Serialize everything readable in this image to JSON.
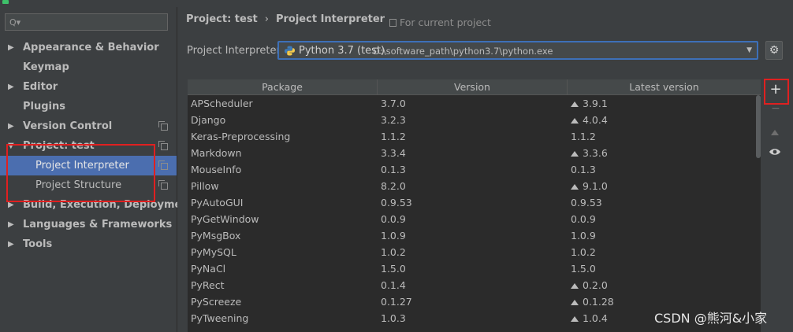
{
  "search": {
    "placeholder": ""
  },
  "sidebar": {
    "items": [
      {
        "label": "Appearance & Behavior",
        "expandable": true,
        "arrow": "▶"
      },
      {
        "label": "Keymap",
        "expandable": false
      },
      {
        "label": "Editor",
        "expandable": true,
        "arrow": "▶"
      },
      {
        "label": "Plugins",
        "expandable": false
      },
      {
        "label": "Version Control",
        "expandable": true,
        "arrow": "▶",
        "copy_icon": true
      },
      {
        "label": "Project: test",
        "expandable": true,
        "arrow": "▼",
        "copy_icon": true
      },
      {
        "label": "Project Interpreter",
        "child": true,
        "selected": true,
        "copy_icon": true
      },
      {
        "label": "Project Structure",
        "child": true,
        "copy_icon": true
      },
      {
        "label": "Build, Execution, Deployment",
        "expandable": true,
        "arrow": "▶"
      },
      {
        "label": "Languages & Frameworks",
        "expandable": true,
        "arrow": "▶"
      },
      {
        "label": "Tools",
        "expandable": true,
        "arrow": "▶"
      }
    ]
  },
  "header": {
    "crumb_project": "Project: test",
    "crumb_sep": "›",
    "crumb_page": "Project Interpreter",
    "scope": "For current project"
  },
  "interpreter": {
    "label": "Project Interpreter:",
    "name": "Python 3.7 (test)",
    "path": "D:\\software_path\\python3.7\\python.exe"
  },
  "table": {
    "columns": [
      "Package",
      "Version",
      "Latest version"
    ],
    "rows": [
      {
        "package": "APScheduler",
        "version": "3.7.0",
        "latest": "3.9.1",
        "upgrade": true
      },
      {
        "package": "Django",
        "version": "3.2.3",
        "latest": "4.0.4",
        "upgrade": true
      },
      {
        "package": "Keras-Preprocessing",
        "version": "1.1.2",
        "latest": "1.1.2",
        "upgrade": false
      },
      {
        "package": "Markdown",
        "version": "3.3.4",
        "latest": "3.3.6",
        "upgrade": true
      },
      {
        "package": "MouseInfo",
        "version": "0.1.3",
        "latest": "0.1.3",
        "upgrade": false
      },
      {
        "package": "Pillow",
        "version": "8.2.0",
        "latest": "9.1.0",
        "upgrade": true
      },
      {
        "package": "PyAutoGUI",
        "version": "0.9.53",
        "latest": "0.9.53",
        "upgrade": false
      },
      {
        "package": "PyGetWindow",
        "version": "0.0.9",
        "latest": "0.0.9",
        "upgrade": false
      },
      {
        "package": "PyMsgBox",
        "version": "1.0.9",
        "latest": "1.0.9",
        "upgrade": false
      },
      {
        "package": "PyMySQL",
        "version": "1.0.2",
        "latest": "1.0.2",
        "upgrade": false
      },
      {
        "package": "PyNaCl",
        "version": "1.5.0",
        "latest": "1.5.0",
        "upgrade": false
      },
      {
        "package": "PyRect",
        "version": "0.1.4",
        "latest": "0.2.0",
        "upgrade": true
      },
      {
        "package": "PyScreeze",
        "version": "0.1.27",
        "latest": "0.1.28",
        "upgrade": true
      },
      {
        "package": "PyTweening",
        "version": "1.0.3",
        "latest": "1.0.4",
        "upgrade": true
      }
    ]
  },
  "toolbar": {
    "add": "+",
    "remove": "−"
  },
  "watermark": "CSDN @熊河&小家",
  "colors": {
    "selection": "#4b6eaf",
    "highlight_box": "#e02020",
    "combo_border": "#3d70b8"
  }
}
